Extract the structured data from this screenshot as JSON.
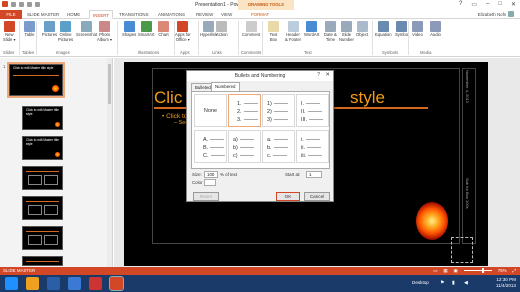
{
  "window": {
    "title": "Presentation1 - PowerPoint",
    "contextual_group": "DRAWING TOOLS",
    "controls": [
      "?",
      "▭",
      "–",
      "□",
      "✕"
    ]
  },
  "tabs": [
    "FILE",
    "SLIDE MASTER",
    "HOME",
    "INSERT",
    "TRANSITIONS",
    "ANIMATIONS",
    "REVIEW",
    "VIEW",
    "FORMAT"
  ],
  "user": "Elizabeth Nofs",
  "ribbon": {
    "buttons": [
      {
        "label": "New\nSlide ▾",
        "color": "#d24726"
      },
      {
        "label": "Table",
        "color": "#7a9ccc"
      },
      {
        "label": "Pictures",
        "color": "#6aa0c8"
      },
      {
        "label": "Online\nPictures",
        "color": "#5aa0c8"
      },
      {
        "label": "Screenshot",
        "color": "#8ab"
      },
      {
        "label": "Photo\nAlbum ▾",
        "color": "#c88"
      },
      {
        "label": "Shapes",
        "color": "#4a8cd4"
      },
      {
        "label": "SmartArt",
        "color": "#4a9a4a"
      },
      {
        "label": "Chart",
        "color": "#d87"
      },
      {
        "label": "Apps for\nOffice ▾",
        "color": "#d24726"
      },
      {
        "label": "Hyperlink",
        "color": "#9ab"
      },
      {
        "label": "Action",
        "color": "#bbb"
      },
      {
        "label": "Comment",
        "color": "#ccc"
      },
      {
        "label": "Text\nBox",
        "color": "#e9d8a8"
      },
      {
        "label": "Header\n& Footer",
        "color": "#bcd"
      },
      {
        "label": "WordArt",
        "color": "#4a8cd4"
      },
      {
        "label": "Date &\nTime",
        "color": "#9ab"
      },
      {
        "label": "Slide\nNumber",
        "color": "#9ab"
      },
      {
        "label": "Object",
        "color": "#abc"
      },
      {
        "label": "Equation",
        "color": "#6a8ab0"
      },
      {
        "label": "Symbol",
        "color": "#6a8ab0"
      },
      {
        "label": "Video",
        "color": "#8a9ab8"
      },
      {
        "label": "Audio",
        "color": "#8a9ab8"
      }
    ],
    "groups": [
      "Slides",
      "Tables",
      "Images",
      "Illustrations",
      "Apps",
      "Links",
      "Comments",
      "Text",
      "Symbols",
      "Media"
    ]
  },
  "thumbnails": {
    "numbers": [
      "1"
    ],
    "labels": [
      "Click to edit Master\ntitle style"
    ]
  },
  "slide": {
    "title_left": "Clic",
    "title_right": "style",
    "bullet1": "• Click to",
    "bullet2": "– Secon",
    "vertical_top": "November 4, 2013",
    "vertical_bottom": "Sub for Box 100s"
  },
  "dialog": {
    "title": "Bullets and Numbering",
    "help": "?",
    "close": "✕",
    "tabs": [
      "Bulleted",
      "Numbered"
    ],
    "none_label": "None",
    "cells": [
      [
        "1.",
        "2.",
        "3."
      ],
      [
        "1)",
        "2)",
        "3)"
      ],
      [
        "I.",
        "II.",
        "III."
      ],
      [
        "A.",
        "B.",
        "C."
      ],
      [
        "a)",
        "b)",
        "c)"
      ],
      [
        "a.",
        "b.",
        "c."
      ],
      [
        "i.",
        "ii.",
        "iii."
      ]
    ],
    "size_label": "Size:",
    "size_value": "100",
    "size_unit": "% of text",
    "start_label": "Start at:",
    "start_value": "1",
    "color_label": "Color",
    "reset_label": "Reset",
    "ok_label": "OK",
    "cancel_label": "Cancel"
  },
  "statusbar": {
    "left": "SLIDE MASTER",
    "zoom": "75%"
  },
  "taskbar": {
    "desktop_label": "Desktop",
    "time": "12:30 PM",
    "date": "11/4/2013",
    "icons": [
      "#1e90ff",
      "#f0a020",
      "#2a5fa8",
      "#3a7ad4",
      "#cc3333",
      "#d24726"
    ]
  }
}
